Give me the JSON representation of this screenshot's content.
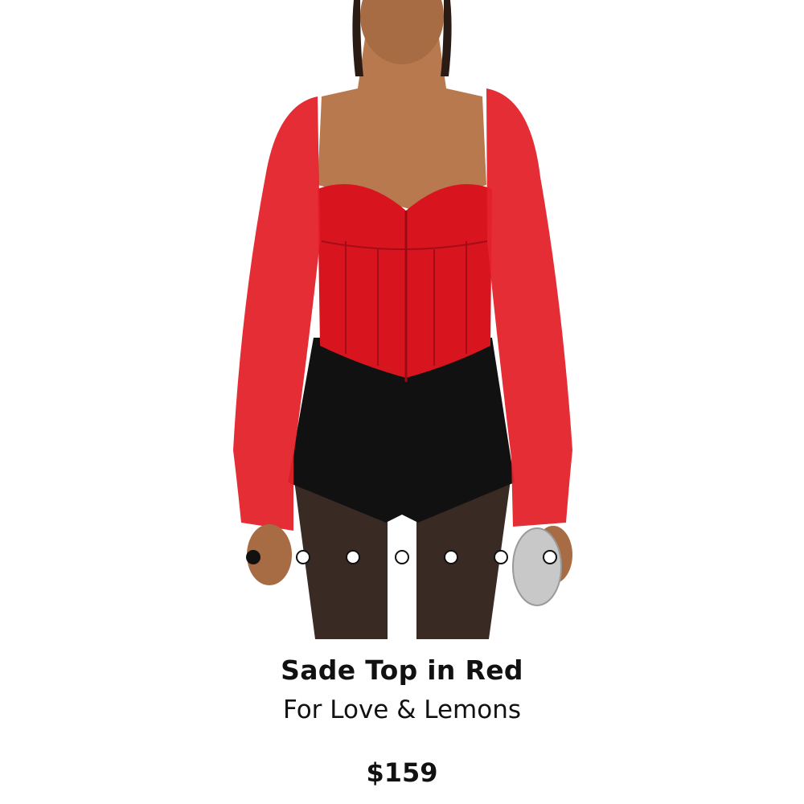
{
  "product": {
    "title": "Sade Top in Red",
    "brand": "For Love & Lemons",
    "price": "$159"
  },
  "gallery": {
    "image_count": 7,
    "active_index": 0,
    "image_description_icon": "model-photo"
  },
  "colors": {
    "top": "#d8141f",
    "shorts": "#111111",
    "text": "#111111"
  }
}
